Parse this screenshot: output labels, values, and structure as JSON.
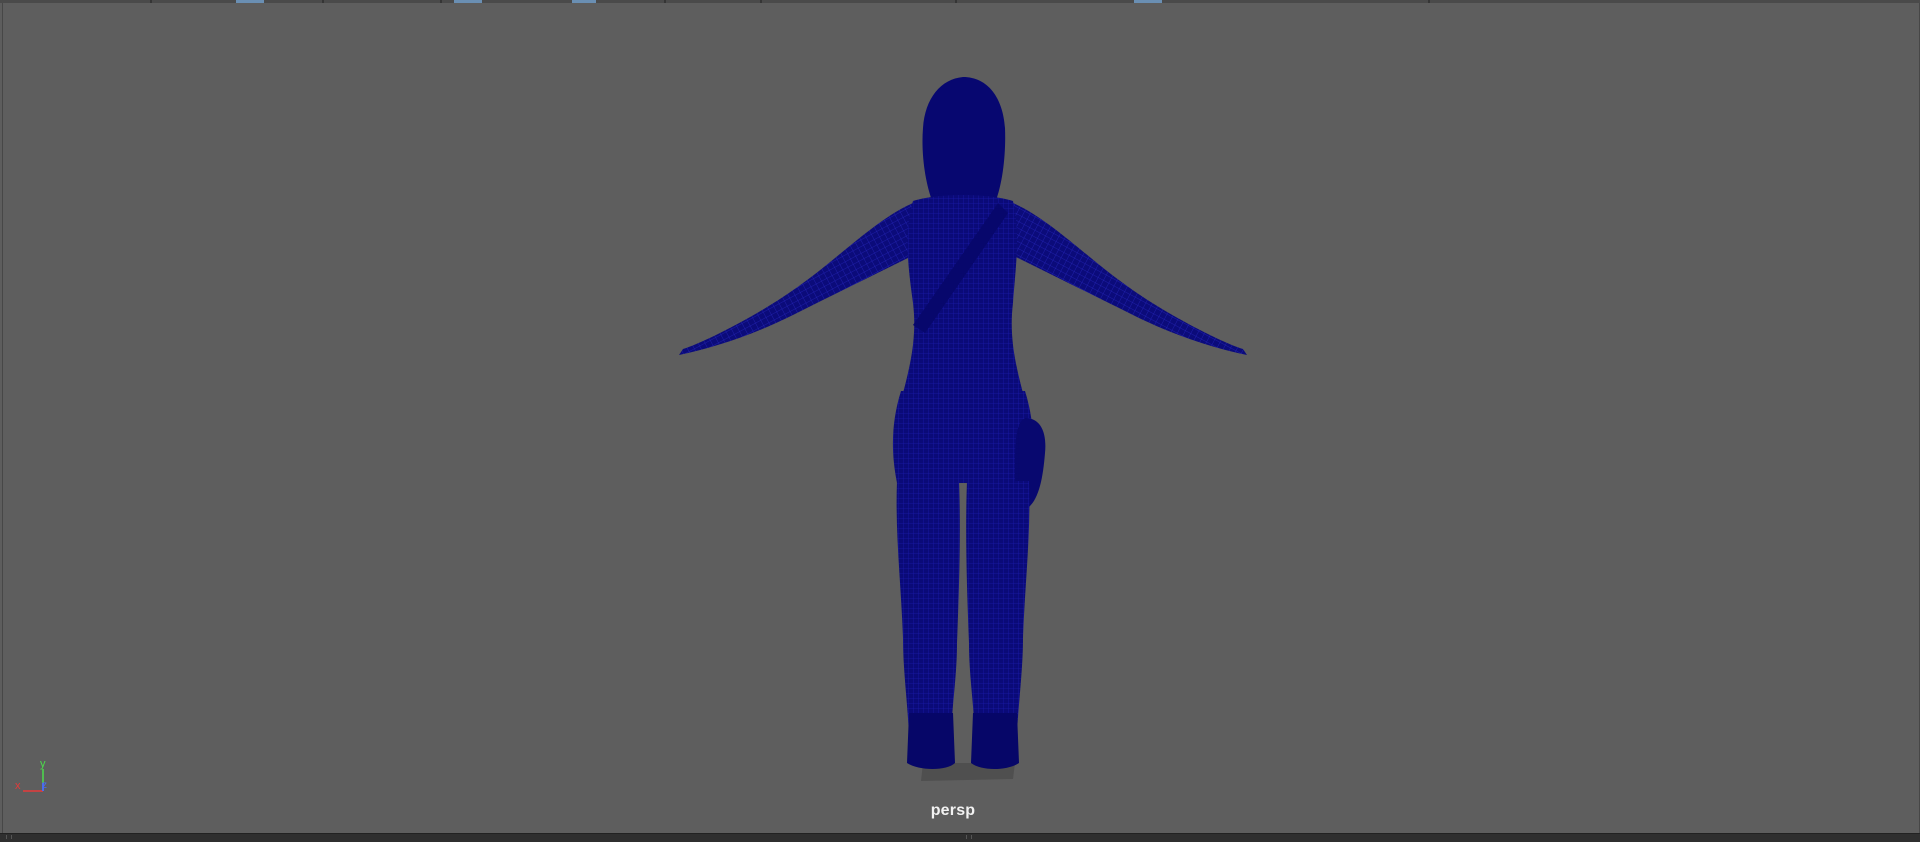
{
  "viewport": {
    "camera_label": "persp",
    "background_color": "#5e5e5e",
    "mesh_color": "#000080",
    "display_mode": "wireframe"
  },
  "axis_gizmo": {
    "x_label": "x",
    "y_label": "y",
    "z_label": "z",
    "x_color": "#e53a3a",
    "y_color": "#4bdc4b",
    "z_color": "#4a6cf0"
  },
  "model": {
    "icon": "character-wireframe-icon",
    "pose": "T-pose"
  }
}
